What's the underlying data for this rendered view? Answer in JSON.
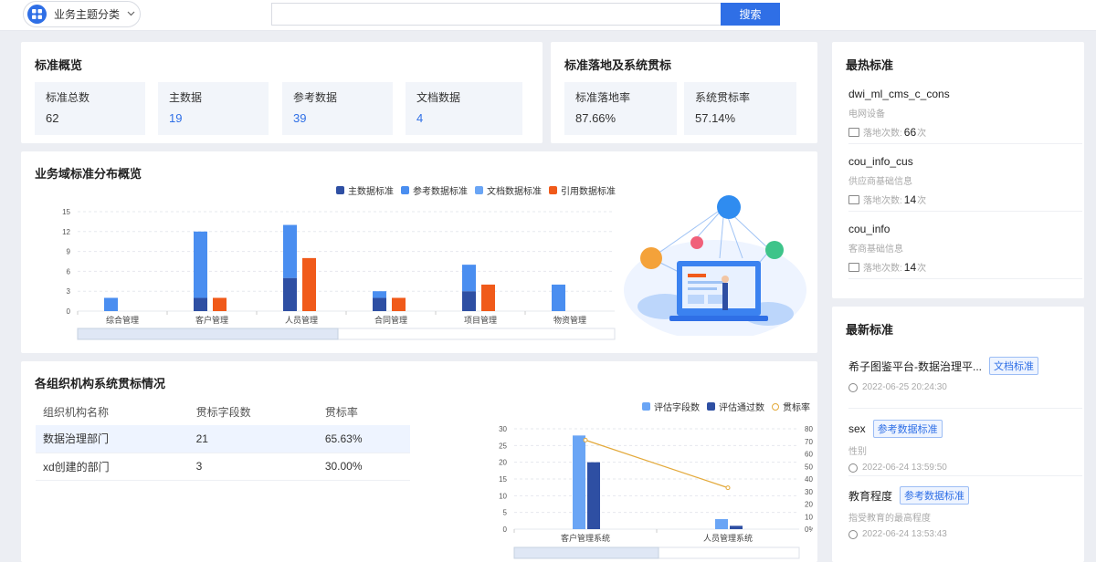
{
  "topbar": {
    "category_label": "业务主题分类",
    "search_placeholder": "",
    "search_label": "搜索"
  },
  "overview": {
    "title": "标准概览",
    "stats": [
      {
        "label": "标准总数",
        "value": "62"
      },
      {
        "label": "主数据",
        "value": "19"
      },
      {
        "label": "参考数据",
        "value": "39"
      },
      {
        "label": "文档数据",
        "value": "4"
      }
    ]
  },
  "landing": {
    "title": "标准落地及系统贯标",
    "stats": [
      {
        "label": "标准落地率",
        "value": "87.66%"
      },
      {
        "label": "系统贯标率",
        "value": "57.14%"
      }
    ]
  },
  "hottest": {
    "title": "最热标准",
    "count_prefix": "落地次数:",
    "count_suffix": "次",
    "items": [
      {
        "name": "dwi_ml_cms_c_cons",
        "desc": "电网设备",
        "count": "66"
      },
      {
        "name": "cou_info_cus",
        "desc": "供应商基础信息",
        "count": "14"
      },
      {
        "name": "cou_info",
        "desc": "客商基础信息",
        "count": "14"
      }
    ]
  },
  "newest": {
    "title": "最新标准",
    "items": [
      {
        "name": "希子图鉴平台-数据治理平...",
        "tag": "文档标准",
        "desc": "",
        "time": "2022-06-25 20:24:30"
      },
      {
        "name": "sex",
        "tag": "参考数据标准",
        "desc": "性别",
        "time": "2022-06-24 13:59:50"
      },
      {
        "name": "教育程度",
        "tag": "参考数据标准",
        "desc": "指受教育的最高程度",
        "time": "2022-06-24 13:53:43"
      }
    ]
  },
  "domain_chart_title": "业务域标准分布概览",
  "org_section": {
    "title": "各组织机构系统贯标情况",
    "columns": [
      "组织机构名称",
      "贯标字段数",
      "贯标率"
    ],
    "rows": [
      [
        "数据治理部门",
        "21",
        "65.63%"
      ],
      [
        "xd创建的部门",
        "3",
        "30.00%"
      ]
    ]
  },
  "colors": {
    "accent": "#2f6fe6",
    "main": "#2e4fa3",
    "ref": "#4a8ef0",
    "doc": "#6aa5f5",
    "cite": "#f05a1a",
    "rate_line": "#e3a93a"
  },
  "chart_data": [
    {
      "type": "bar",
      "stacked": true,
      "categories": [
        "综合管理",
        "客户管理",
        "人员管理",
        "合同管理",
        "项目管理",
        "物资管理"
      ],
      "series": [
        {
          "name": "主数据标准",
          "values": [
            0,
            2,
            5,
            2,
            3,
            0
          ]
        },
        {
          "name": "参考数据标准",
          "values": [
            2,
            10,
            8,
            1,
            4,
            4
          ]
        },
        {
          "name": "文档数据标准",
          "values": [
            0,
            0,
            0,
            0,
            0,
            0
          ]
        },
        {
          "name": "引用数据标准",
          "values": [
            0,
            2,
            8,
            2,
            4,
            0
          ]
        }
      ],
      "yticks": [
        "0",
        "3",
        "6",
        "9",
        "12",
        "15"
      ],
      "ylim": [
        0,
        15
      ],
      "legend": "top"
    },
    {
      "type": "bar",
      "categories": [
        "客户管理系统",
        "人员管理系统"
      ],
      "series": [
        {
          "name": "评估字段数",
          "values": [
            28,
            3
          ]
        },
        {
          "name": "评估通过数",
          "values": [
            20,
            1
          ]
        },
        {
          "name": "贯标率",
          "line": true,
          "values": [
            71,
            33
          ]
        }
      ],
      "yticks_left": [
        "0",
        "5",
        "10",
        "15",
        "20",
        "25",
        "30"
      ],
      "yticks_right": [
        "0%",
        "10%",
        "20%",
        "30%",
        "40%",
        "50%",
        "60%",
        "70%",
        "80%"
      ],
      "ylim": [
        0,
        30
      ],
      "ylim_right": [
        0,
        80
      ],
      "legend": "top-right"
    }
  ]
}
